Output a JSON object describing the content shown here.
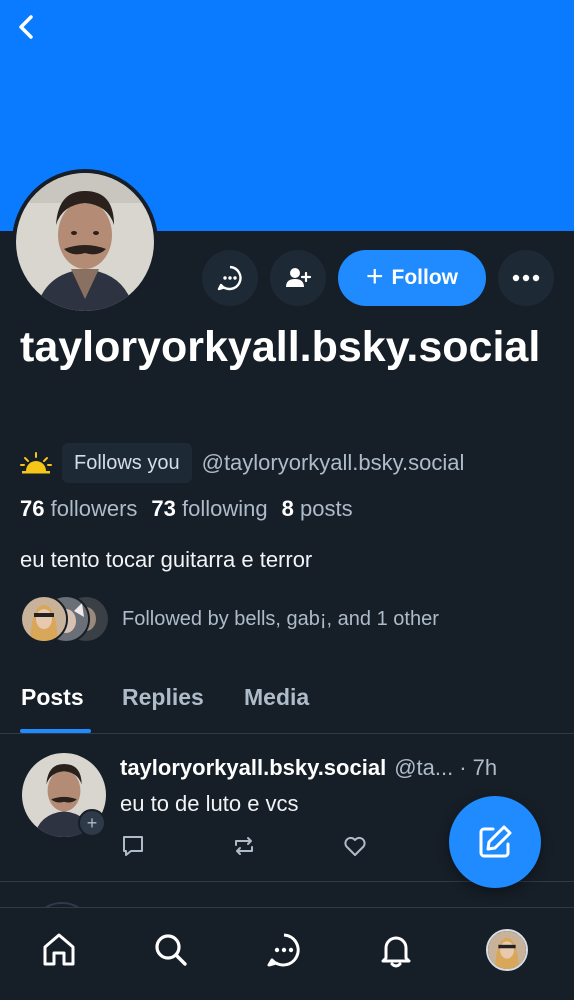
{
  "colors": {
    "accent": "#208bfe",
    "banner": "#0a7aff",
    "background": "#161e27",
    "muted": "#aebbc9"
  },
  "header": {
    "back_icon": "chevron-left-icon"
  },
  "profile": {
    "display_name": "tayloryorkyall.bsky.social",
    "follows_you_label": "Follows you",
    "handle": "@tayloryorkyall.bsky.social",
    "stats": {
      "followers_count": "76",
      "followers_label": "followers",
      "following_count": "73",
      "following_label": "following",
      "posts_count": "8",
      "posts_label": "posts"
    },
    "bio": "eu tento tocar guitarra e terror",
    "followed_by": "Followed by bells, gab¡, and 1 other"
  },
  "actions": {
    "follow_label": "Follow",
    "message_icon": "chat-bubble-icon",
    "add_user_icon": "person-add-icon",
    "more_icon": "ellipsis-icon"
  },
  "tabs": [
    {
      "label": "Posts",
      "active": true
    },
    {
      "label": "Replies",
      "active": false
    },
    {
      "label": "Media",
      "active": false
    }
  ],
  "posts": [
    {
      "author_name": "tayloryorkyall.bsky.social",
      "author_handle": "@ta...",
      "time": "· 7h",
      "text": "eu to de luto e vcs"
    }
  ],
  "bottom_nav": [
    {
      "icon": "home-icon"
    },
    {
      "icon": "search-icon"
    },
    {
      "icon": "chat-icon"
    },
    {
      "icon": "bell-icon"
    },
    {
      "icon": "profile-avatar"
    }
  ]
}
